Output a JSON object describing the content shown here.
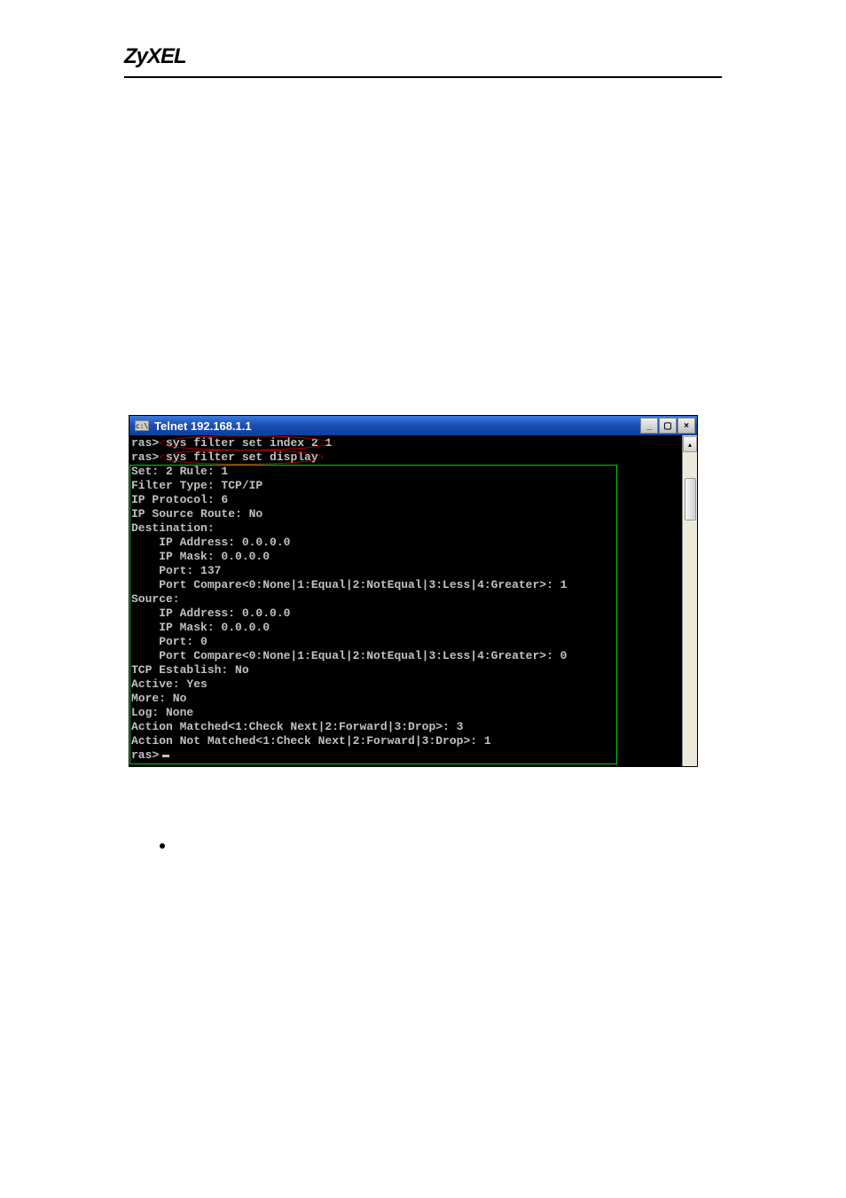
{
  "header": {
    "logo_text": "ZyXEL"
  },
  "window": {
    "icon_label": "c:\\",
    "title": "Telnet 192.168.1.1",
    "buttons": {
      "min": "_",
      "max": "▢",
      "close": "×"
    },
    "scroll_up_glyph": "▴"
  },
  "terminal": {
    "line1_prompt": "ras>",
    "line1_cmd": " sys filter set index 2 1",
    "line2_prompt": "ras>",
    "line2_cmd": " sys filter set display",
    "l3": "Set: 2 Rule: 1",
    "l4": "Filter Type: TCP/IP",
    "l5": "IP Protocol: 6",
    "l6": "IP Source Route: No",
    "l7": "Destination:",
    "l8": "    IP Address: 0.0.0.0",
    "l9": "    IP Mask: 0.0.0.0",
    "l10": "    Port: 137",
    "l11": "    Port Compare<0:None|1:Equal|2:NotEqual|3:Less|4:Greater>: 1",
    "l12": "Source:",
    "l13": "    IP Address: 0.0.0.0",
    "l14": "    IP Mask: 0.0.0.0",
    "l15": "    Port: 0",
    "l16": "    Port Compare<0:None|1:Equal|2:NotEqual|3:Less|4:Greater>: 0",
    "l17": "TCP Establish: No",
    "l18": "Active: Yes",
    "l19": "More: No",
    "l20": "Log: None",
    "l21": "Action Matched<1:Check Next|2:Forward|3:Drop>: 3",
    "l22": "Action Not Matched<1:Check Next|2:Forward|3:Drop>: 1",
    "l23_prompt": "ras>"
  }
}
